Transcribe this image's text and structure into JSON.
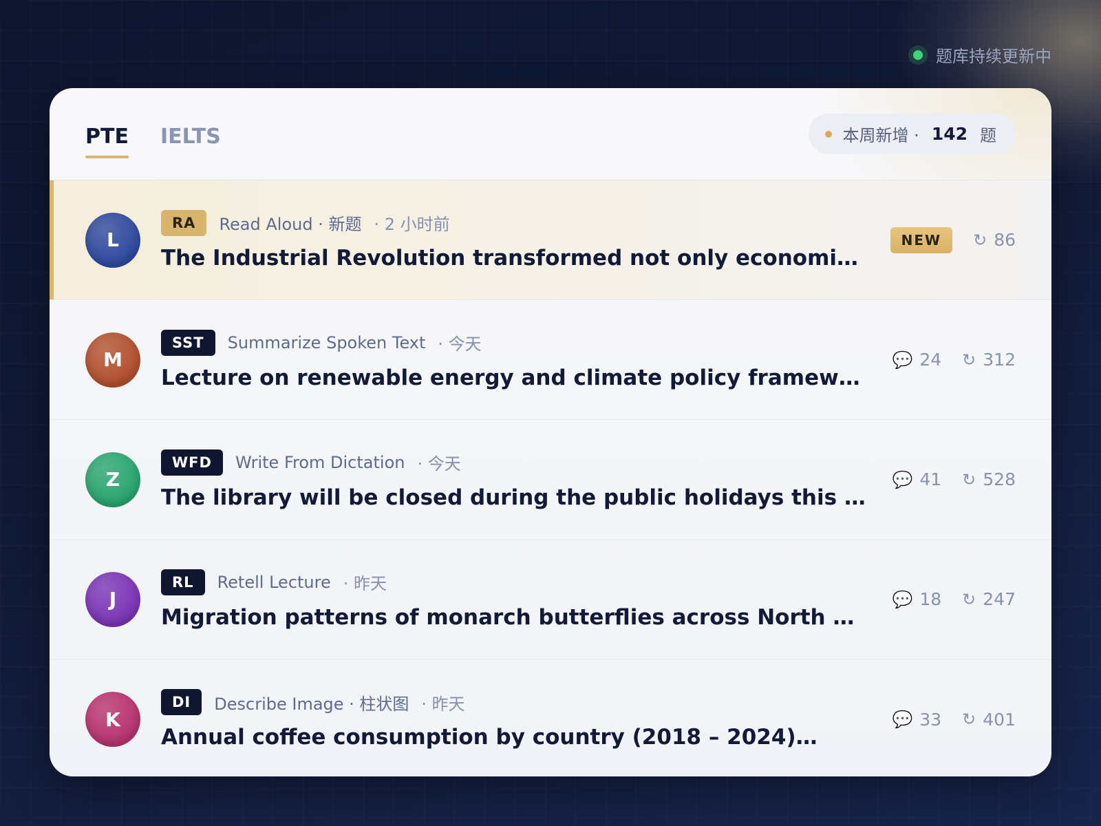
{
  "status": {
    "label": "题库持续更新中"
  },
  "header": {
    "tabs": [
      {
        "label": "PTE",
        "active": true
      },
      {
        "label": "IELTS",
        "active": false
      }
    ],
    "weekly": {
      "prefix": "本周新增 ·",
      "count": "142",
      "suffix": "题"
    }
  },
  "items": [
    {
      "avatar": "L",
      "avatar_color": "#2f4aa0",
      "badge": "RA",
      "badge_style": "gold",
      "category": "Read Aloud · 新题",
      "time": "· 2 小时前",
      "title": "The Industrial Revolution transformed not only economies but also societies",
      "new_tag": "NEW",
      "comments": null,
      "views": "86",
      "highlight": true
    },
    {
      "avatar": "M",
      "avatar_color": "#b2502e",
      "badge": "SST",
      "badge_style": "dark",
      "category": "Summarize Spoken Text",
      "time": "· 今天",
      "title": "Lecture on renewable energy and climate policy frameworks",
      "new_tag": null,
      "comments": "24",
      "views": "312",
      "highlight": false
    },
    {
      "avatar": "Z",
      "avatar_color": "#2aa56f",
      "badge": "WFD",
      "badge_style": "dark",
      "category": "Write From Dictation",
      "time": "· 今天",
      "title": "The library will be closed during the public holidays this week",
      "new_tag": null,
      "comments": "41",
      "views": "528",
      "highlight": false
    },
    {
      "avatar": "J",
      "avatar_color": "#7b35b5",
      "badge": "RL",
      "badge_style": "dark",
      "category": "Retell Lecture",
      "time": "· 昨天",
      "title": "Migration patterns of monarch butterflies across North America",
      "new_tag": null,
      "comments": "18",
      "views": "247",
      "highlight": false
    },
    {
      "avatar": "K",
      "avatar_color": "#b8336f",
      "badge": "DI",
      "badge_style": "dark",
      "category": "Describe Image · 柱状图",
      "time": "· 昨天",
      "title": "Annual coffee consumption by country (2018 – 2024)…",
      "new_tag": null,
      "comments": "33",
      "views": "401",
      "highlight": false
    }
  ],
  "icons": {
    "comment": "comment-icon",
    "views": "refresh-icon"
  }
}
